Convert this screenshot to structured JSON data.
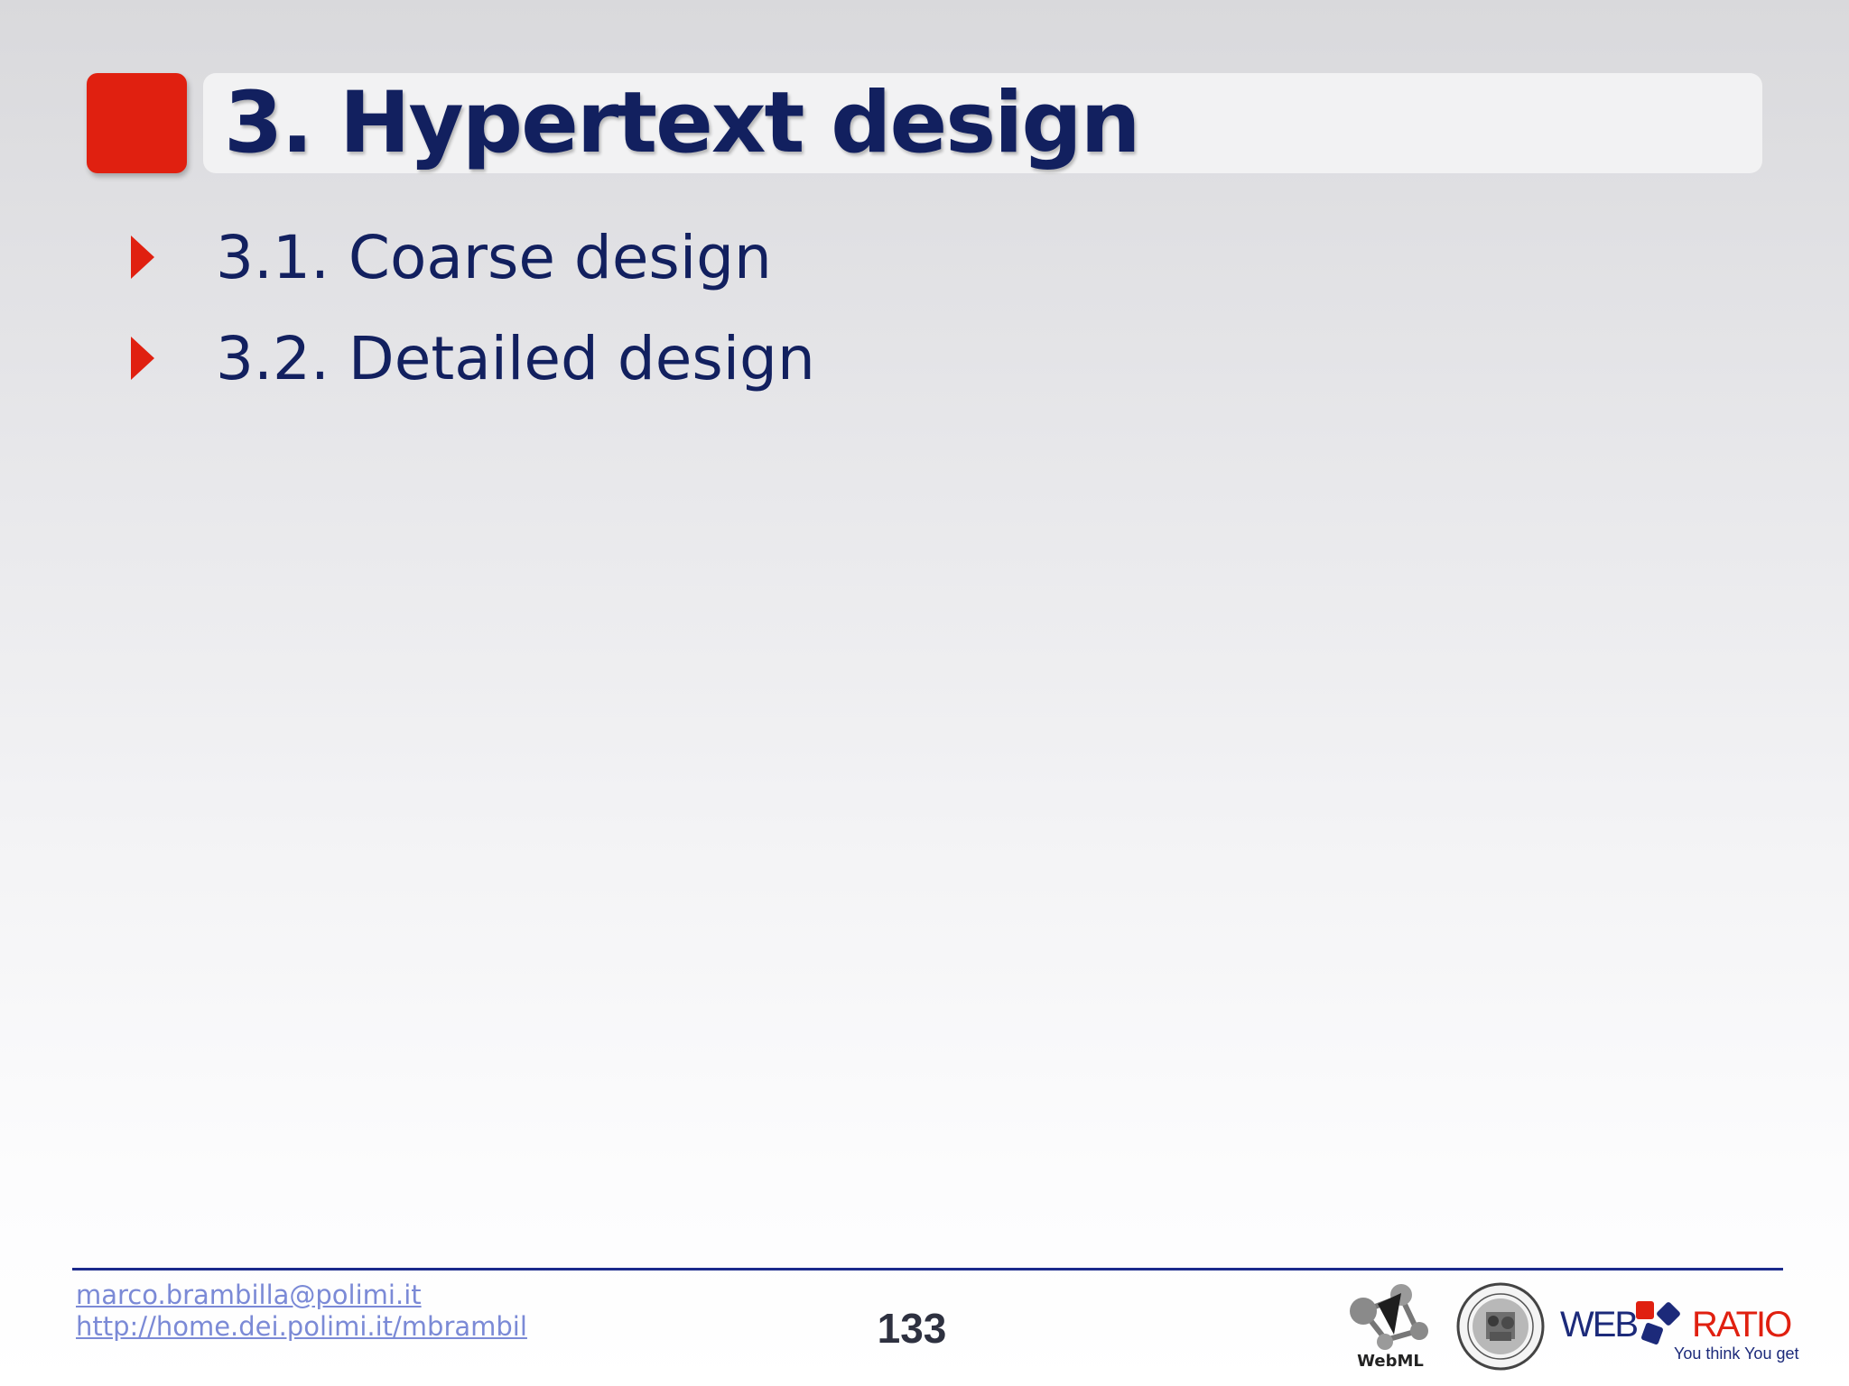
{
  "slide": {
    "title": "3. Hypertext design",
    "bullets": [
      {
        "text": "3.1. Coarse design"
      },
      {
        "text": "3.2. Detailed design"
      }
    ]
  },
  "footer": {
    "email": "marco.brambilla@polimi.it",
    "url": "http://home.dei.polimi.it/mbrambil",
    "page_number": "133",
    "logos": {
      "webml_label": "WebML",
      "webratio_web": "WEB",
      "webratio_ratio": "RATIO",
      "webratio_tagline": "You think You get"
    }
  },
  "colors": {
    "accent_red": "#e02010",
    "navy": "#12205f",
    "link": "#7b8ad6",
    "footer_rule": "#1b2a8c"
  }
}
